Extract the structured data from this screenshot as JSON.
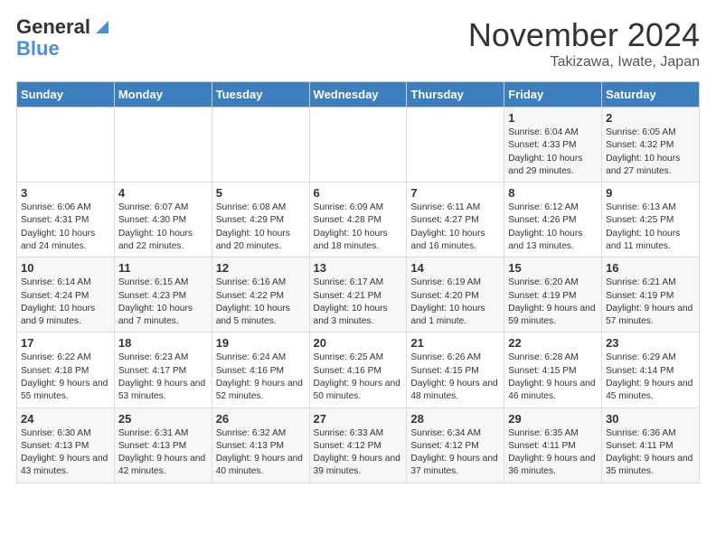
{
  "logo": {
    "line1": "General",
    "line2": "Blue"
  },
  "title": "November 2024",
  "location": "Takizawa, Iwate, Japan",
  "days_of_week": [
    "Sunday",
    "Monday",
    "Tuesday",
    "Wednesday",
    "Thursday",
    "Friday",
    "Saturday"
  ],
  "weeks": [
    [
      {
        "day": "",
        "content": ""
      },
      {
        "day": "",
        "content": ""
      },
      {
        "day": "",
        "content": ""
      },
      {
        "day": "",
        "content": ""
      },
      {
        "day": "",
        "content": ""
      },
      {
        "day": "1",
        "content": "Sunrise: 6:04 AM\nSunset: 4:33 PM\nDaylight: 10 hours and 29 minutes."
      },
      {
        "day": "2",
        "content": "Sunrise: 6:05 AM\nSunset: 4:32 PM\nDaylight: 10 hours and 27 minutes."
      }
    ],
    [
      {
        "day": "3",
        "content": "Sunrise: 6:06 AM\nSunset: 4:31 PM\nDaylight: 10 hours and 24 minutes."
      },
      {
        "day": "4",
        "content": "Sunrise: 6:07 AM\nSunset: 4:30 PM\nDaylight: 10 hours and 22 minutes."
      },
      {
        "day": "5",
        "content": "Sunrise: 6:08 AM\nSunset: 4:29 PM\nDaylight: 10 hours and 20 minutes."
      },
      {
        "day": "6",
        "content": "Sunrise: 6:09 AM\nSunset: 4:28 PM\nDaylight: 10 hours and 18 minutes."
      },
      {
        "day": "7",
        "content": "Sunrise: 6:11 AM\nSunset: 4:27 PM\nDaylight: 10 hours and 16 minutes."
      },
      {
        "day": "8",
        "content": "Sunrise: 6:12 AM\nSunset: 4:26 PM\nDaylight: 10 hours and 13 minutes."
      },
      {
        "day": "9",
        "content": "Sunrise: 6:13 AM\nSunset: 4:25 PM\nDaylight: 10 hours and 11 minutes."
      }
    ],
    [
      {
        "day": "10",
        "content": "Sunrise: 6:14 AM\nSunset: 4:24 PM\nDaylight: 10 hours and 9 minutes."
      },
      {
        "day": "11",
        "content": "Sunrise: 6:15 AM\nSunset: 4:23 PM\nDaylight: 10 hours and 7 minutes."
      },
      {
        "day": "12",
        "content": "Sunrise: 6:16 AM\nSunset: 4:22 PM\nDaylight: 10 hours and 5 minutes."
      },
      {
        "day": "13",
        "content": "Sunrise: 6:17 AM\nSunset: 4:21 PM\nDaylight: 10 hours and 3 minutes."
      },
      {
        "day": "14",
        "content": "Sunrise: 6:19 AM\nSunset: 4:20 PM\nDaylight: 10 hours and 1 minute."
      },
      {
        "day": "15",
        "content": "Sunrise: 6:20 AM\nSunset: 4:19 PM\nDaylight: 9 hours and 59 minutes."
      },
      {
        "day": "16",
        "content": "Sunrise: 6:21 AM\nSunset: 4:19 PM\nDaylight: 9 hours and 57 minutes."
      }
    ],
    [
      {
        "day": "17",
        "content": "Sunrise: 6:22 AM\nSunset: 4:18 PM\nDaylight: 9 hours and 55 minutes."
      },
      {
        "day": "18",
        "content": "Sunrise: 6:23 AM\nSunset: 4:17 PM\nDaylight: 9 hours and 53 minutes."
      },
      {
        "day": "19",
        "content": "Sunrise: 6:24 AM\nSunset: 4:16 PM\nDaylight: 9 hours and 52 minutes."
      },
      {
        "day": "20",
        "content": "Sunrise: 6:25 AM\nSunset: 4:16 PM\nDaylight: 9 hours and 50 minutes."
      },
      {
        "day": "21",
        "content": "Sunrise: 6:26 AM\nSunset: 4:15 PM\nDaylight: 9 hours and 48 minutes."
      },
      {
        "day": "22",
        "content": "Sunrise: 6:28 AM\nSunset: 4:15 PM\nDaylight: 9 hours and 46 minutes."
      },
      {
        "day": "23",
        "content": "Sunrise: 6:29 AM\nSunset: 4:14 PM\nDaylight: 9 hours and 45 minutes."
      }
    ],
    [
      {
        "day": "24",
        "content": "Sunrise: 6:30 AM\nSunset: 4:13 PM\nDaylight: 9 hours and 43 minutes."
      },
      {
        "day": "25",
        "content": "Sunrise: 6:31 AM\nSunset: 4:13 PM\nDaylight: 9 hours and 42 minutes."
      },
      {
        "day": "26",
        "content": "Sunrise: 6:32 AM\nSunset: 4:13 PM\nDaylight: 9 hours and 40 minutes."
      },
      {
        "day": "27",
        "content": "Sunrise: 6:33 AM\nSunset: 4:12 PM\nDaylight: 9 hours and 39 minutes."
      },
      {
        "day": "28",
        "content": "Sunrise: 6:34 AM\nSunset: 4:12 PM\nDaylight: 9 hours and 37 minutes."
      },
      {
        "day": "29",
        "content": "Sunrise: 6:35 AM\nSunset: 4:11 PM\nDaylight: 9 hours and 36 minutes."
      },
      {
        "day": "30",
        "content": "Sunrise: 6:36 AM\nSunset: 4:11 PM\nDaylight: 9 hours and 35 minutes."
      }
    ]
  ]
}
